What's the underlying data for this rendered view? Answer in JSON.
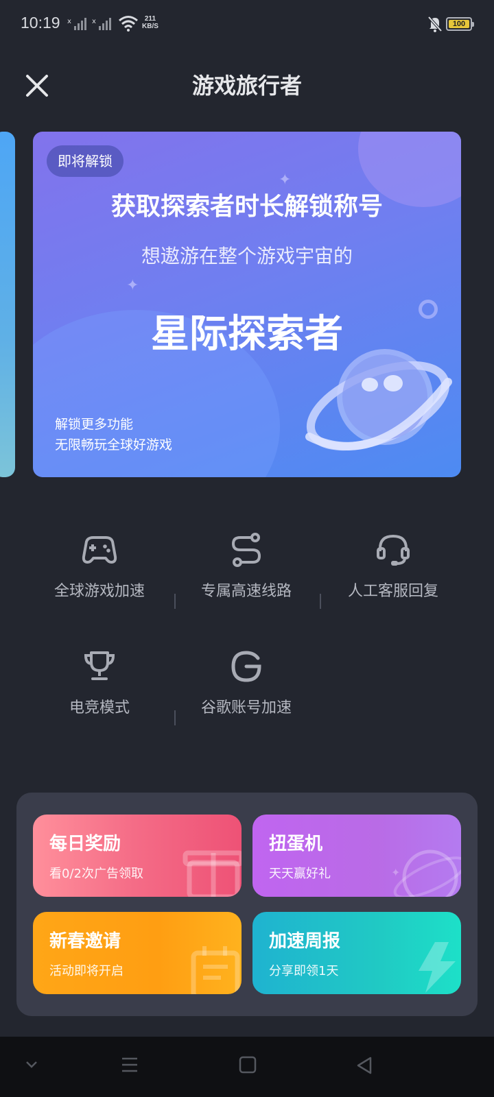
{
  "status_bar": {
    "time": "10:19",
    "net_speed_value": "211",
    "net_speed_unit": "KB/S",
    "battery": "100"
  },
  "header": {
    "title": "游戏旅行者"
  },
  "banner": {
    "badge": "即将解锁",
    "headline": "获取探索者时长解锁称号",
    "subheadline": "想遨游在整个游戏宇宙的",
    "rank_name": "星际探索者",
    "note_line1": "解锁更多功能",
    "note_line2": "无限畅玩全球好游戏"
  },
  "features": [
    {
      "label": "全球游戏加速",
      "icon": "gamepad-icon"
    },
    {
      "label": "专属高速线路",
      "icon": "route-icon"
    },
    {
      "label": "人工客服回复",
      "icon": "headset-icon"
    },
    {
      "label": "电竞模式",
      "icon": "trophy-icon"
    },
    {
      "label": "谷歌账号加速",
      "icon": "google-icon"
    }
  ],
  "tiles": {
    "daily": {
      "title": "每日奖励",
      "subtitle": "看0/2次广告领取"
    },
    "gacha": {
      "title": "扭蛋机",
      "subtitle": "天天赢好礼"
    },
    "invite": {
      "title": "新春邀请",
      "subtitle": "活动即将开启"
    },
    "report": {
      "title": "加速周报",
      "subtitle": "分享即领1天"
    }
  },
  "colors": {
    "background": "#23262f",
    "panel": "#3a3d4b",
    "banner_start": "#8273ec",
    "banner_end": "#4d8bf2",
    "daily_tile": "#f46b86",
    "gacha_tile": "#b96be6",
    "invite_tile": "#ff9e12",
    "report_tile": "#20c9c4"
  }
}
